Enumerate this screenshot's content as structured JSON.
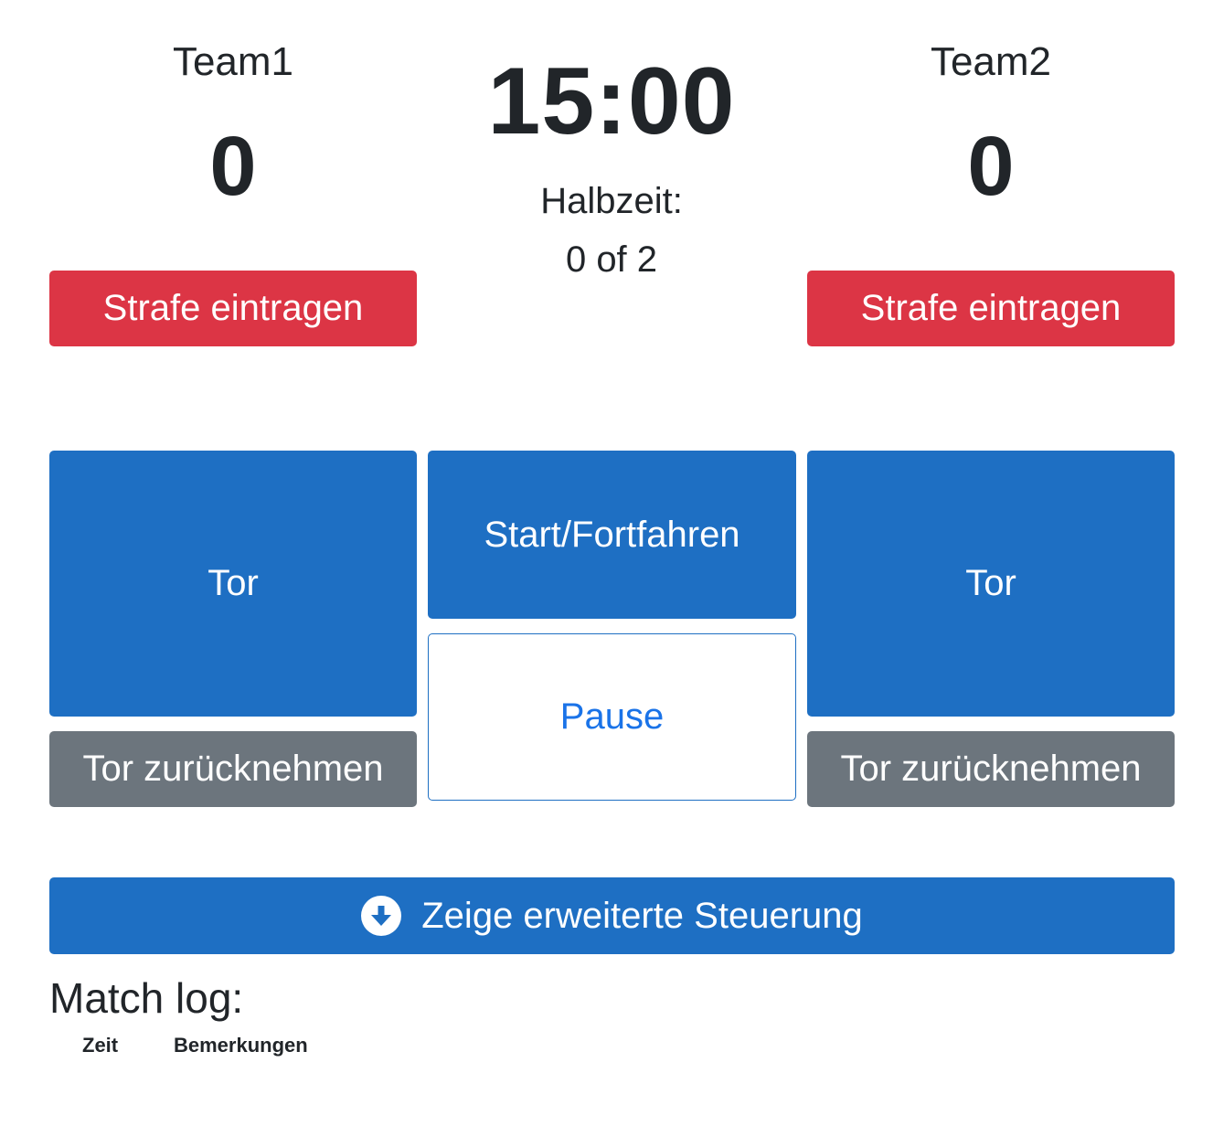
{
  "team1": {
    "name": "Team1",
    "score": "0",
    "penalty_label": "Strafe eintragen",
    "goal_label": "Tor",
    "undo_goal_label": "Tor zurücknehmen"
  },
  "team2": {
    "name": "Team2",
    "score": "0",
    "penalty_label": "Strafe eintragen",
    "goal_label": "Tor",
    "undo_goal_label": "Tor zurücknehmen"
  },
  "clock": {
    "time": "15:00",
    "half_label": "Halbzeit:",
    "half_value": "0 of 2",
    "start_label": "Start/Fortfahren",
    "pause_label": "Pause"
  },
  "advanced": {
    "label": "Zeige erweiterte Steuerung",
    "icon": "arrow-down-circle-icon"
  },
  "match_log": {
    "title": "Match log:",
    "columns": [
      "Zeit",
      "Bemerkungen"
    ]
  },
  "colors": {
    "danger": "#dc3545",
    "primary": "#1e6fc3",
    "secondary": "#6c757d",
    "outline_text": "#1a73e8"
  }
}
